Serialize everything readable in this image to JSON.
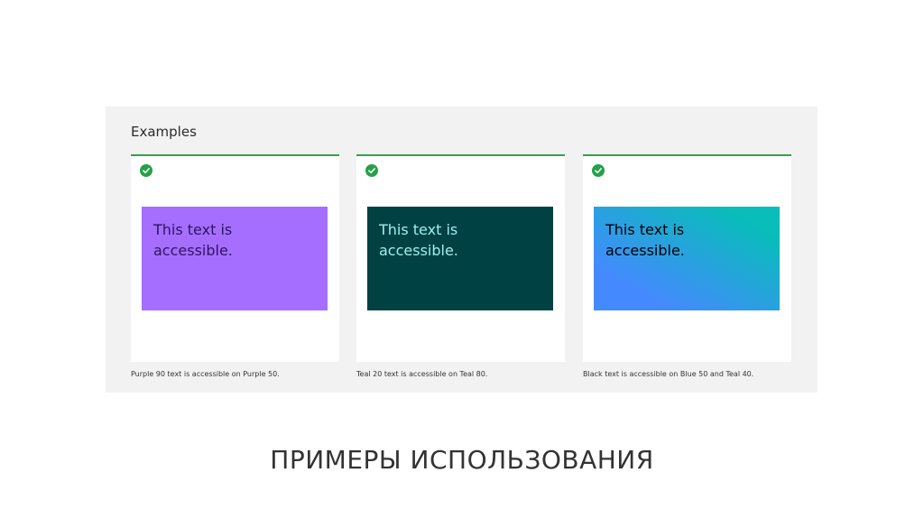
{
  "examples": {
    "title": "Examples",
    "cards": [
      {
        "swatch_text": "This text is accessible.",
        "caption": "Purple 90 text is accessible on Purple 50.",
        "bg": "#a56eff",
        "fg": "#31135e",
        "icon": "check-circle-icon"
      },
      {
        "swatch_text": "This text is accessible.",
        "caption": "Teal 20 text is accessible on Teal 80.",
        "bg": "#004144",
        "fg": "#9ef0f0",
        "icon": "check-circle-icon"
      },
      {
        "swatch_text": "This text is accessible.",
        "caption": "Black text is accessible on Blue 50 and Teal 40.",
        "bg_from": "#4589ff",
        "bg_to": "#08bdba",
        "fg": "#000000",
        "icon": "check-circle-icon"
      }
    ]
  },
  "slide": {
    "title": "ПРИМЕРЫ ИСПОЛЬЗОВАНИЯ"
  },
  "colors": {
    "accent_green": "#2da44e",
    "panel_bg": "#f2f2f2"
  }
}
